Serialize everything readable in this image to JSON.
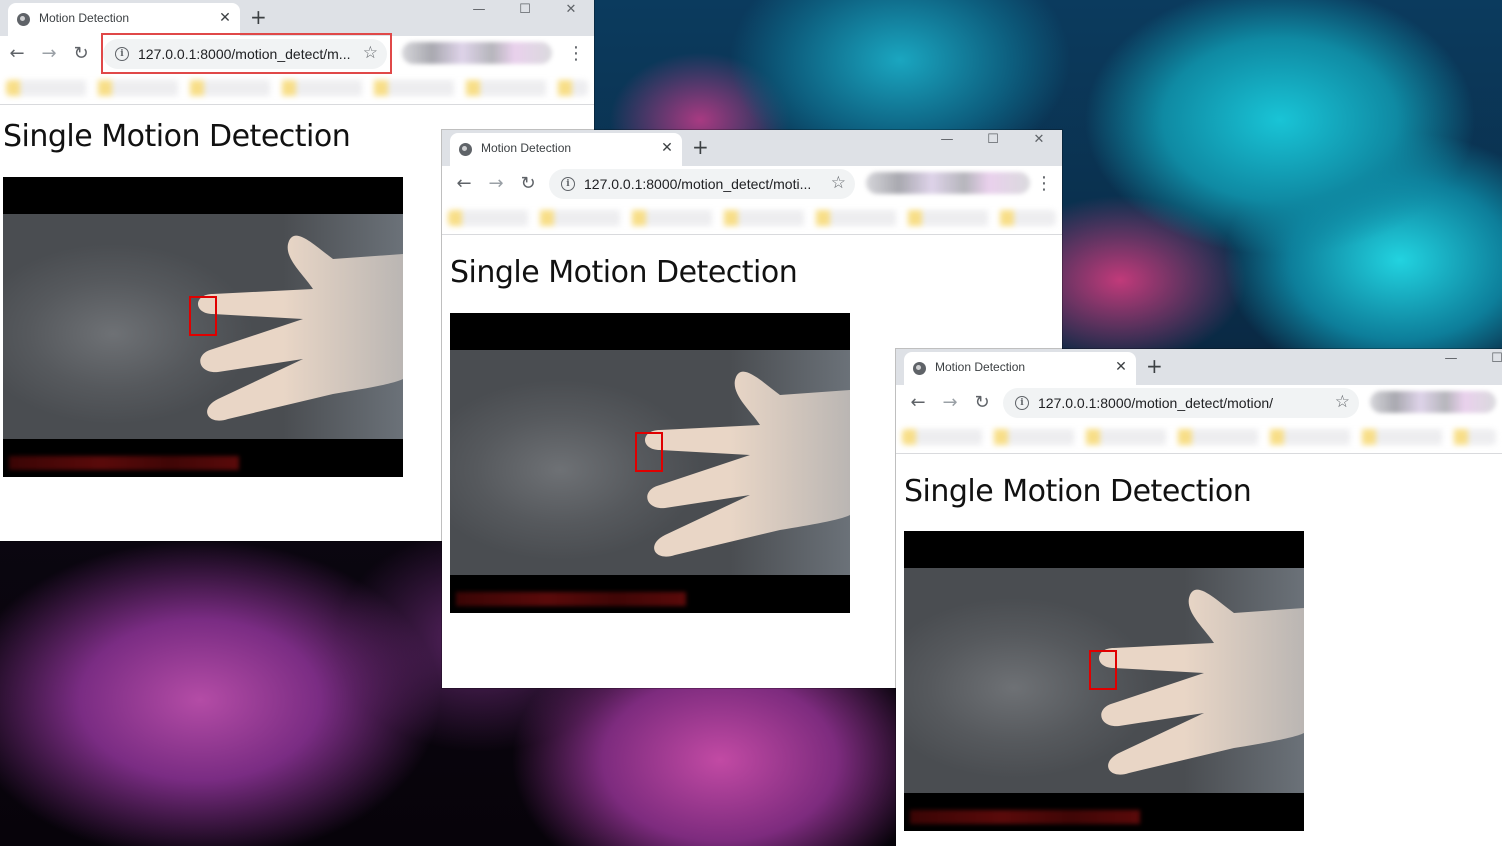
{
  "desktop": {
    "wallpaper": "ink-cloud-teal-magenta"
  },
  "windows": [
    {
      "tab_title": "Motion Detection",
      "url": "127.0.0.1:8000/motion_detect/m...",
      "heading": "Single Motion Detection"
    },
    {
      "tab_title": "Motion Detection",
      "url": "127.0.0.1:8000/motion_detect/moti...",
      "heading": "Single Motion Detection"
    },
    {
      "tab_title": "Motion Detection",
      "url": "127.0.0.1:8000/motion_detect/motion/",
      "heading": "Single Motion Detection"
    }
  ],
  "icons": {
    "tab_close": "✕",
    "new_tab": "+",
    "back": "←",
    "forward": "→",
    "reload": "↻",
    "info": "i",
    "star": "☆",
    "menu": "⋮",
    "minimize": "—",
    "maximize": "☐",
    "close": "✕"
  },
  "colors": {
    "motion_box": "#e00000",
    "url_highlight": "#e04848",
    "chrome_frame": "#dee1e6"
  }
}
